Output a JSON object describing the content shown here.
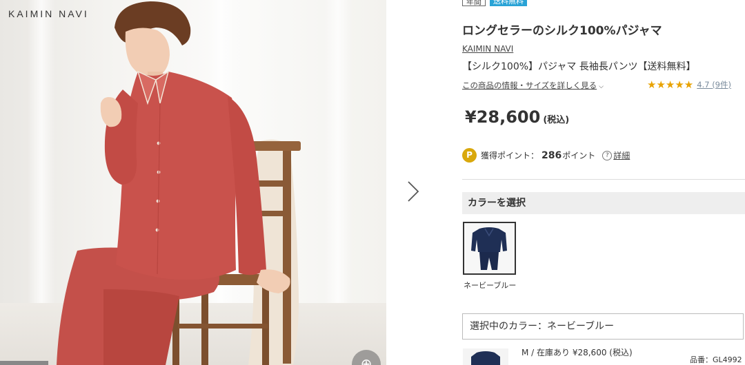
{
  "brand_logo": "KAIMIN NAVI",
  "badges": [
    "年間",
    "送料無料"
  ],
  "product": {
    "name": "ロングセラーのシルク100%パジャマ",
    "brand": "KAIMIN NAVI",
    "subtitle": "【シルク100%】パジャマ 長袖長パンツ【送料無料】",
    "details_link": "この商品の情報・サイズを詳しく見る",
    "rating_stars": "★★★★★",
    "rating_text": "4.7 (9件)",
    "rating_value": 4.7,
    "price": "¥28,600",
    "tax_label": "(税込)"
  },
  "points": {
    "icon_letter": "P",
    "label": "獲得ポイント：",
    "value": "286",
    "unit": "ポイント",
    "help_label": "詳細"
  },
  "color_section": {
    "header": "カラーを選択",
    "swatch_label": "ネービーブルー",
    "selected_text": "選択中のカラー：ネービーブルー"
  },
  "variant": {
    "line": "M / 在庫あり ¥28,600 (税込)",
    "sku": "品番：GL4992"
  },
  "colors": {
    "price_text": "#333333",
    "star": "#e8a200",
    "point_icon": "#d9a80c",
    "free_shipping_badge": "#29a3d6",
    "pajama_red": "#c9524c",
    "navy": "#1f2f55"
  }
}
